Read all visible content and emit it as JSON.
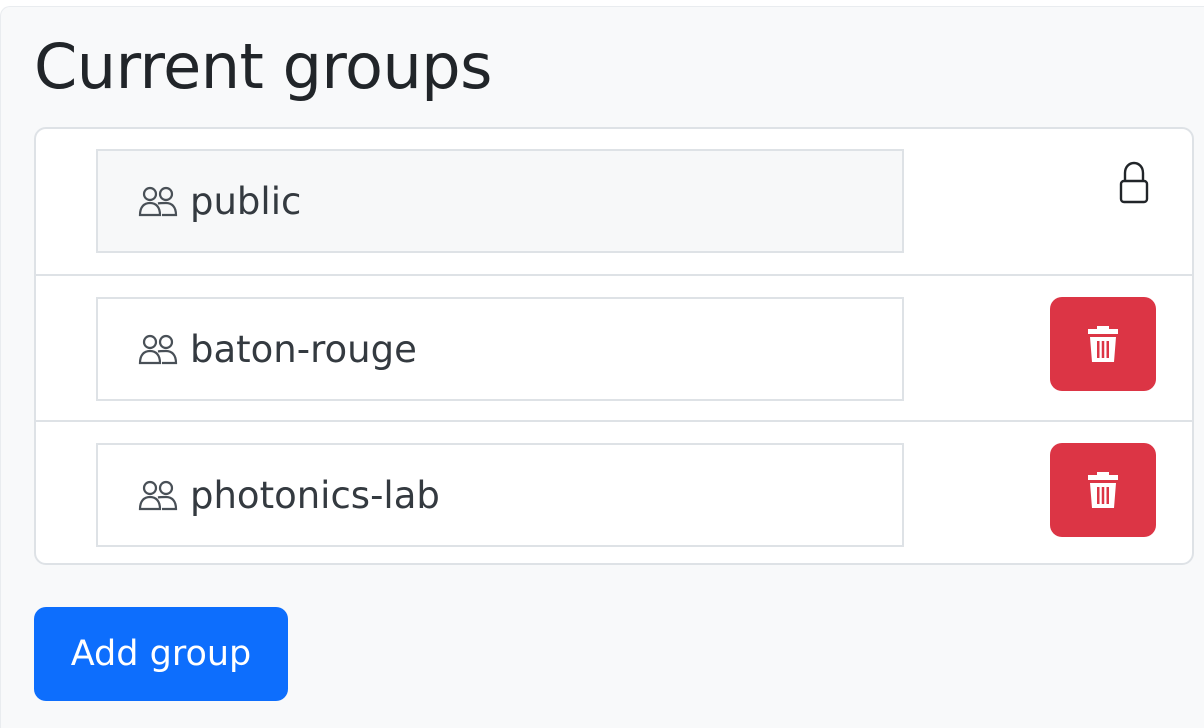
{
  "title": "Current groups",
  "groups": [
    {
      "name": "public",
      "icon": "people-icon",
      "action_icon": "lock-icon",
      "locked": true
    },
    {
      "name": "baton-rouge",
      "icon": "people-icon",
      "action_icon": "trash-icon",
      "locked": false
    },
    {
      "name": "photonics-lab",
      "icon": "people-icon",
      "action_icon": "trash-icon",
      "locked": false
    }
  ],
  "add_button_label": "Add group",
  "colors": {
    "primary": "#0d6efd",
    "danger": "#dc3545",
    "panel_bg": "#f8f9fa",
    "border": "#dee2e6"
  }
}
